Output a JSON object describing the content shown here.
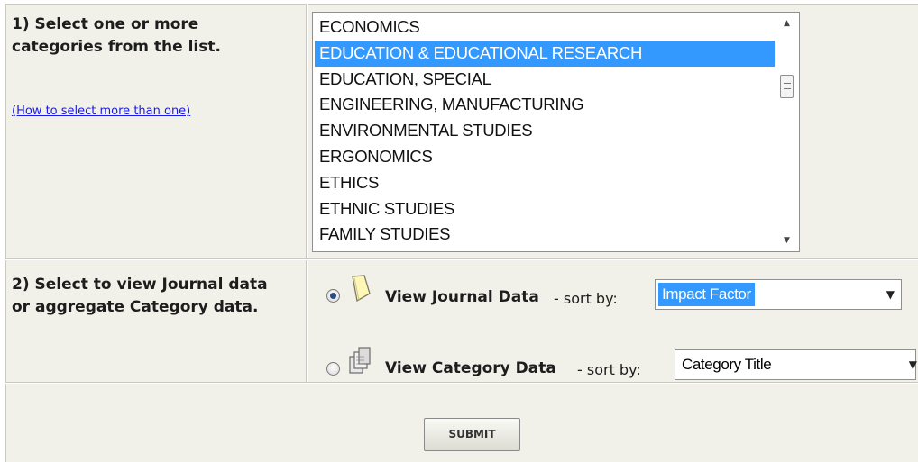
{
  "step1": {
    "heading_line1": "1) Select one or more",
    "heading_line2": "categories from the list.",
    "help_link": "(How to select more than one)"
  },
  "category_list": {
    "items": [
      {
        "label": "ECONOMICS",
        "selected": false
      },
      {
        "label": "EDUCATION & EDUCATIONAL RESEARCH",
        "selected": true
      },
      {
        "label": "EDUCATION, SPECIAL",
        "selected": false
      },
      {
        "label": "ENGINEERING, MANUFACTURING",
        "selected": false
      },
      {
        "label": "ENVIRONMENTAL STUDIES",
        "selected": false
      },
      {
        "label": "ERGONOMICS",
        "selected": false
      },
      {
        "label": "ETHICS",
        "selected": false
      },
      {
        "label": "ETHNIC STUDIES",
        "selected": false
      },
      {
        "label": "FAMILY STUDIES",
        "selected": false
      }
    ],
    "scroll_up_icon": "triangle-up",
    "scroll_down_icon": "triangle-down"
  },
  "step2": {
    "heading_line1": "2) Select to view Journal data",
    "heading_line2": "or aggregate Category data.",
    "journal_option": {
      "label": "View Journal Data",
      "sort_by": "- sort by:",
      "selected_value": "Impact Factor",
      "checked": true,
      "icon": "journal-icon"
    },
    "category_option": {
      "label": "View Category Data",
      "sort_by": "- sort by:",
      "selected_value": "Category Title",
      "checked": false,
      "icon": "category-stack-icon"
    }
  },
  "submit_label": "SUBMIT",
  "colors": {
    "panel_bg": "#f1f1e9",
    "selection": "#3399ff",
    "link": "#1a1ae6"
  }
}
